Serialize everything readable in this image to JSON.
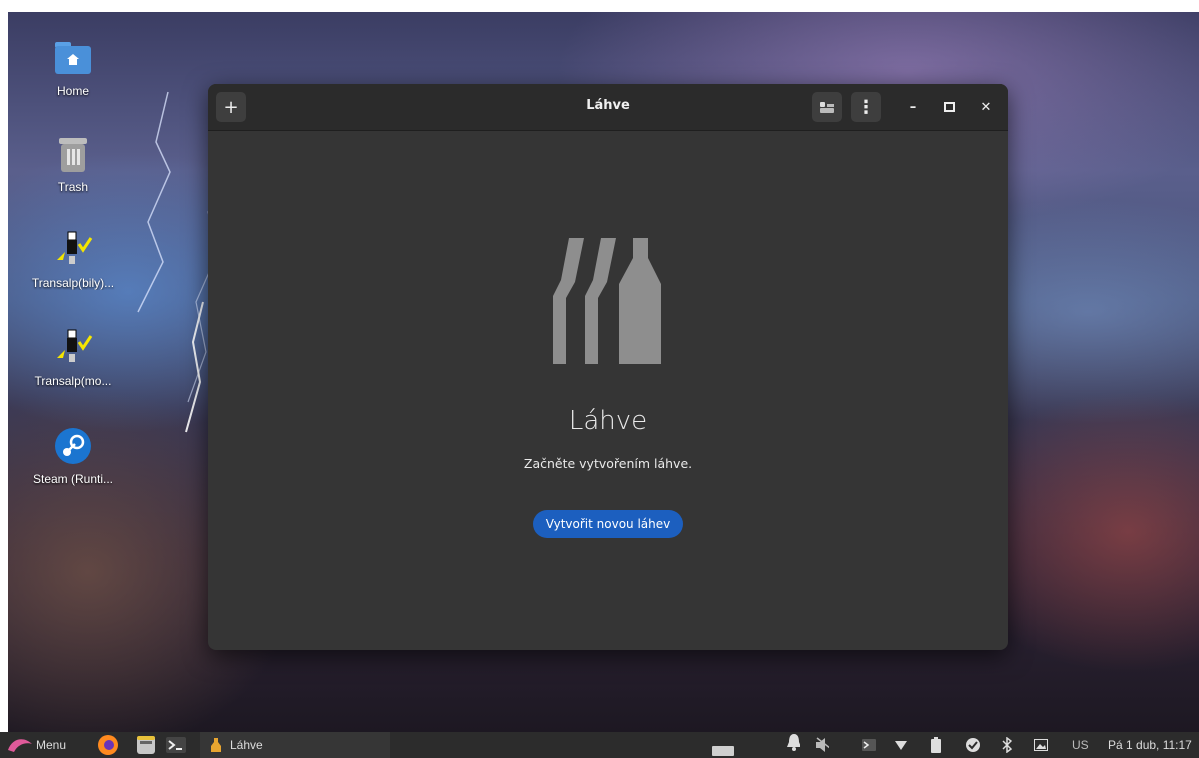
{
  "desktop": {
    "icons": [
      {
        "label": "Home",
        "icon": "home-folder-icon"
      },
      {
        "label": "Trash",
        "icon": "trash-icon"
      },
      {
        "label": "Transalp(bily)...",
        "icon": "transalp-app-icon"
      },
      {
        "label": "Transalp(mo...",
        "icon": "transalp-app-icon"
      },
      {
        "label": "Steam (Runti...",
        "icon": "steam-icon"
      }
    ]
  },
  "window": {
    "title": "Láhve",
    "add_button_glyph": "+",
    "menu_button_glyph": "⋮",
    "minimize_glyph": "–",
    "maximize_glyph": "▫",
    "close_glyph": "✕",
    "empty_state": {
      "title": "Láhve",
      "description": "Začněte vytvořením láhve.",
      "button_label": "Vytvořit novou láhev"
    }
  },
  "taskbar": {
    "menu_label": "Menu",
    "window_button_label": "Láhve",
    "keyboard_layout": "US",
    "clock": "Pá 1 dub, 11:17"
  },
  "colors": {
    "accent": "#1c5fbf",
    "window_bg": "#353535",
    "titlebar_bg": "#2b2b2b",
    "bottle_art": "#8e8e8e"
  }
}
